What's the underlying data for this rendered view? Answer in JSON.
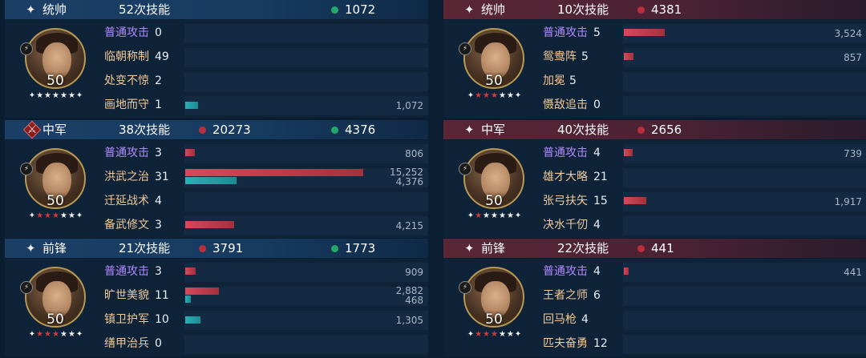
{
  "left": [
    {
      "role": "统帅",
      "role_icon": "star-sparkle",
      "skills": "52次技能",
      "damage": null,
      "heal": "1072",
      "portrait": {
        "level": "50",
        "stars_red": 0
      },
      "rows": [
        {
          "name": "普通攻击",
          "basic": true,
          "count": "0",
          "red": null,
          "teal": null
        },
        {
          "name": "临朝称制",
          "count": "49",
          "red": null,
          "teal": null
        },
        {
          "name": "处变不惊",
          "count": "2",
          "red": null,
          "teal": null
        },
        {
          "name": "画地而守",
          "count": "1",
          "red": null,
          "teal": "1,072",
          "teal_v": 1072
        }
      ]
    },
    {
      "role": "中军",
      "role_icon": "crossed-swords-badge",
      "skills": "38次技能",
      "damage": "20273",
      "heal": "4376",
      "portrait": {
        "level": "50",
        "stars_red": 3
      },
      "rows": [
        {
          "name": "普通攻击",
          "basic": true,
          "count": "3",
          "red": "806",
          "red_v": 806,
          "teal": null
        },
        {
          "name": "洪武之治",
          "count": "31",
          "red": "15,252",
          "red_v": 15252,
          "teal": "4,376",
          "teal_v": 4376
        },
        {
          "name": "迁延战术",
          "count": "4",
          "red": null,
          "teal": null
        },
        {
          "name": "备武修文",
          "count": "3",
          "red": "4,215",
          "red_v": 4215,
          "teal": null
        }
      ]
    },
    {
      "role": "前锋",
      "role_icon": "star-sparkle",
      "skills": "21次技能",
      "damage": "3791",
      "heal": "1773",
      "portrait": {
        "level": "50",
        "stars_red": 3
      },
      "rows": [
        {
          "name": "普通攻击",
          "basic": true,
          "count": "3",
          "red": "909",
          "red_v": 909,
          "teal": null
        },
        {
          "name": "旷世美貌",
          "count": "11",
          "red": "2,882",
          "red_v": 2882,
          "teal": "468",
          "teal_v": 468
        },
        {
          "name": "镇卫护军",
          "count": "10",
          "red": null,
          "teal": "1,305",
          "teal_v": 1305
        },
        {
          "name": "缮甲治兵",
          "count": "0",
          "red": null,
          "teal": null
        }
      ]
    }
  ],
  "right": [
    {
      "role": "统帅",
      "role_icon": "star-sparkle",
      "skills": "10次技能",
      "damage": "4381",
      "heal": null,
      "portrait": {
        "level": "50",
        "stars_red": 3
      },
      "rows": [
        {
          "name": "普通攻击",
          "basic": true,
          "count": "5",
          "red": "3,524",
          "red_v": 3524,
          "teal": null
        },
        {
          "name": "鸳鸯阵",
          "count": "5",
          "red": "857",
          "red_v": 857,
          "teal": null
        },
        {
          "name": "加冕",
          "count": "5",
          "red": null,
          "teal": null
        },
        {
          "name": "慑敌追击",
          "count": "0",
          "red": null,
          "teal": null
        }
      ]
    },
    {
      "role": "中军",
      "role_icon": "star-sparkle",
      "skills": "40次技能",
      "damage": "2656",
      "heal": null,
      "portrait": {
        "level": "50",
        "stars_red": 1
      },
      "rows": [
        {
          "name": "普通攻击",
          "basic": true,
          "count": "4",
          "red": "739",
          "red_v": 739,
          "teal": null
        },
        {
          "name": "雄才大略",
          "count": "21",
          "red": null,
          "teal": null
        },
        {
          "name": "张弓扶矢",
          "count": "15",
          "red": "1,917",
          "red_v": 1917,
          "teal": null
        },
        {
          "name": "决水千仞",
          "count": "4",
          "red": null,
          "teal": null
        }
      ]
    },
    {
      "role": "前锋",
      "role_icon": "star-sparkle",
      "skills": "22次技能",
      "damage": "441",
      "heal": null,
      "portrait": {
        "level": "50",
        "stars_red": 3
      },
      "rows": [
        {
          "name": "普通攻击",
          "basic": true,
          "count": "4",
          "red": "441",
          "red_v": 441,
          "teal": null
        },
        {
          "name": "王者之师",
          "count": "6",
          "red": null,
          "teal": null
        },
        {
          "name": "回马枪",
          "count": "4",
          "red": null,
          "teal": null
        },
        {
          "name": "匹夫奋勇",
          "count": "12",
          "red": null,
          "teal": null
        }
      ]
    }
  ],
  "scale_max": 15252,
  "colors": {
    "damage": "#b8303e",
    "heal": "#24a86a",
    "skill_name": "#f0c89a",
    "basic_attack": "#b28aff"
  }
}
